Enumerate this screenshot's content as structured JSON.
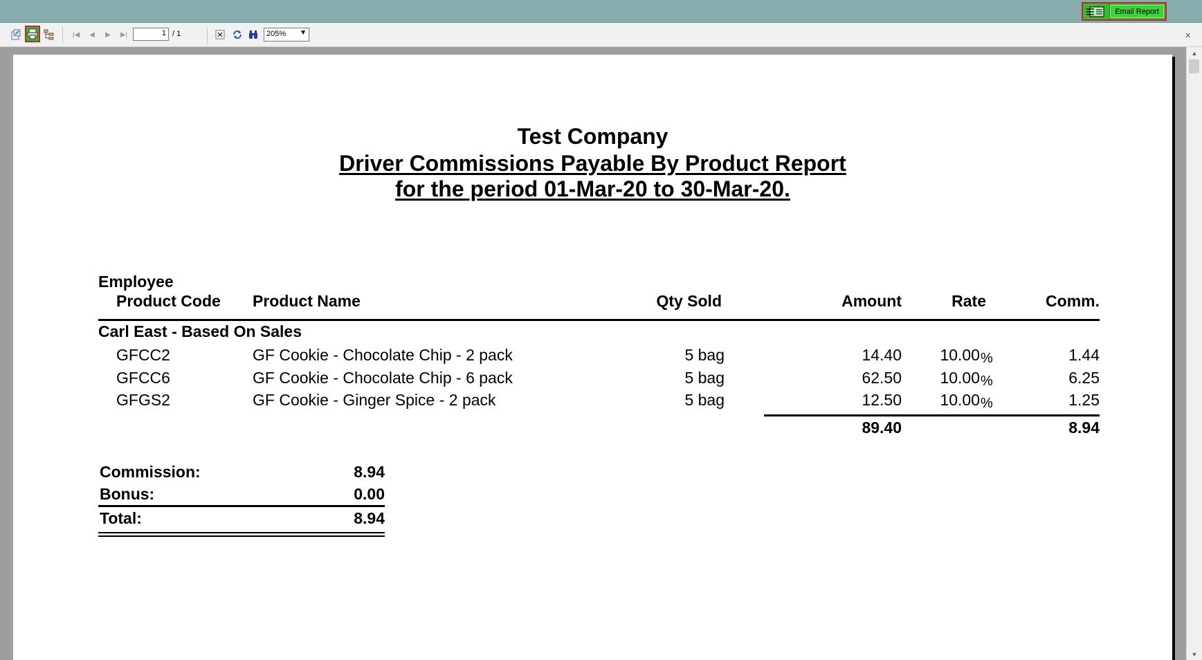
{
  "email": {
    "label": "Email Report",
    "icon": "email-report-icon"
  },
  "toolbar": {
    "icons": [
      "export-icon",
      "print-icon",
      "group-tree-icon",
      "first-page-icon",
      "prev-page-icon",
      "next-page-icon",
      "last-page-icon",
      "stop-icon",
      "refresh-icon",
      "search-icon",
      "close-icon"
    ],
    "page_value": "1",
    "page_total": "/ 1",
    "zoom": "205%"
  },
  "report": {
    "company": "Test Company",
    "title": "Driver Commissions Payable By Product Report",
    "period": "for the period 01-Mar-20 to 30-Mar-20.",
    "headers": {
      "employee": "Employee",
      "product_code": "Product Code",
      "product_name": "Product Name",
      "qty_sold": "Qty Sold",
      "amount": "Amount",
      "rate": "Rate",
      "comm": "Comm."
    },
    "group": "Carl East - Based On Sales",
    "rows": [
      {
        "code": "GFCC2",
        "name": "GF Cookie - Chocolate Chip - 2 pack",
        "qty": "5 bag",
        "amount": "14.40",
        "rate": "10.00",
        "pct": "%",
        "comm": "1.44"
      },
      {
        "code": "GFCC6",
        "name": "GF Cookie - Chocolate Chip - 6 pack",
        "qty": "5 bag",
        "amount": "62.50",
        "rate": "10.00",
        "pct": "%",
        "comm": "6.25"
      },
      {
        "code": "GFGS2",
        "name": "GF Cookie - Ginger Spice - 2 pack",
        "qty": "5 bag",
        "amount": "12.50",
        "rate": "10.00",
        "pct": "%",
        "comm": "1.25"
      }
    ],
    "totals": {
      "amount": "89.40",
      "comm": "8.94"
    },
    "summary": {
      "commission_label": "Commission:",
      "commission_value": "8.94",
      "bonus_label": "Bonus:",
      "bonus_value": "0.00",
      "total_label": "Total:",
      "total_value": "8.94"
    }
  }
}
